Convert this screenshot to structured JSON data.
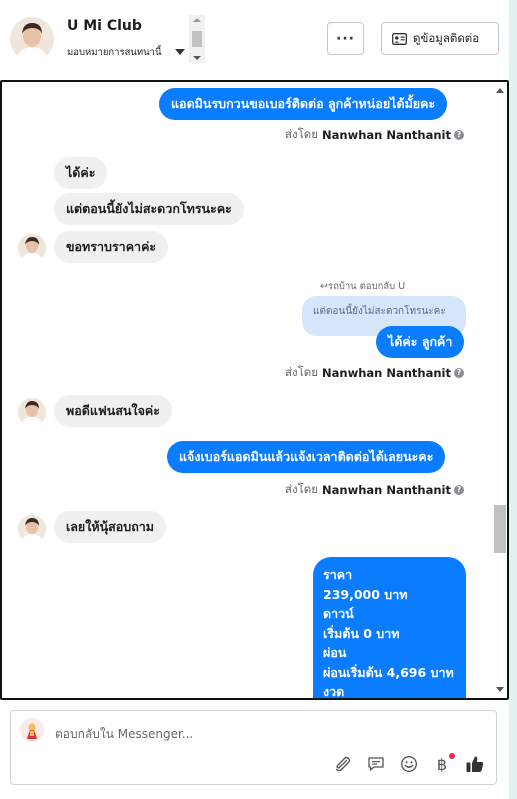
{
  "header": {
    "page_name": "U Mi Club",
    "assign_label": "มอบหมายการสนทนานี้",
    "more_label": "···",
    "contact_label": "ดูข้อมูลติดต่อ"
  },
  "thread": {
    "msg1": "แอดมินรบกวนขอเบอร์ติดต่อ ลูกค้าหน่อยได้มั้ยคะ",
    "sent_by_prefix": "ส่งโดย",
    "sent_by_name": "Nanwhan Nanthanit",
    "in1": "ได้ค่ะ",
    "in2": "แต่ตอนนี้ยังไม่สะดวกโทรนะคะ",
    "in3": "ขอทราบราคาค่ะ",
    "reply_note": "↩รถบ้าน ตอบกลับ U",
    "quoted": "แต่ตอนนี้ยังไม่สะดวกโทรนะคะ",
    "msg2": "ได้ค่ะ ลูกค้า",
    "in4": "พอดีแฟนสนใจค่ะ",
    "msg3": "แจ้งเบอร์แอดมินแล้วแจ้งเวลาติดต่อได้เลยนะคะ",
    "in5": "เลยให้นุ้สอบถาม",
    "price": {
      "line1": "ราคา",
      "line2": "239,000 บาท",
      "line3": "ดาวน์",
      "line4": "เริ่มต้น 0 บาท",
      "line5": "ผ่อน",
      "line6": "ผ่อนเริ่มต้น 4,696 บาท",
      "line7": "งวด"
    }
  },
  "composer": {
    "placeholder": "ตอบกลับใน Messenger...",
    "icons": [
      "paperclip-icon",
      "saved-reply-icon",
      "emoji-icon",
      "payment-icon",
      "like-icon"
    ],
    "baht_symbol": "฿"
  },
  "colors": {
    "outgoing": "#0a7cff",
    "incoming": "#f0f0f0",
    "quote": "#d6e6fb"
  }
}
